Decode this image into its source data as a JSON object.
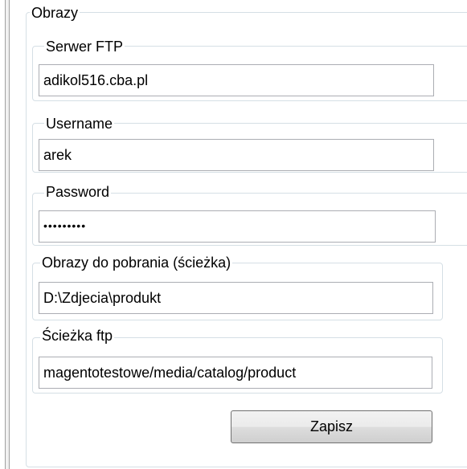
{
  "images_group": {
    "title": "Obrazy"
  },
  "ftp_server": {
    "label": "Serwer FTP",
    "value": "adikol516.cba.pl"
  },
  "username": {
    "label": "Username",
    "value": "arek"
  },
  "password": {
    "label": "Password",
    "value": "•••••••••"
  },
  "download_path": {
    "label": "Obrazy do pobrania (ścieżka)",
    "value": "D:\\Zdjecia\\produkt"
  },
  "ftp_path": {
    "label": "Ścieżka ftp",
    "value": "magentotestowe/media/catalog/product"
  },
  "save_button": {
    "label": "Zapisz"
  }
}
